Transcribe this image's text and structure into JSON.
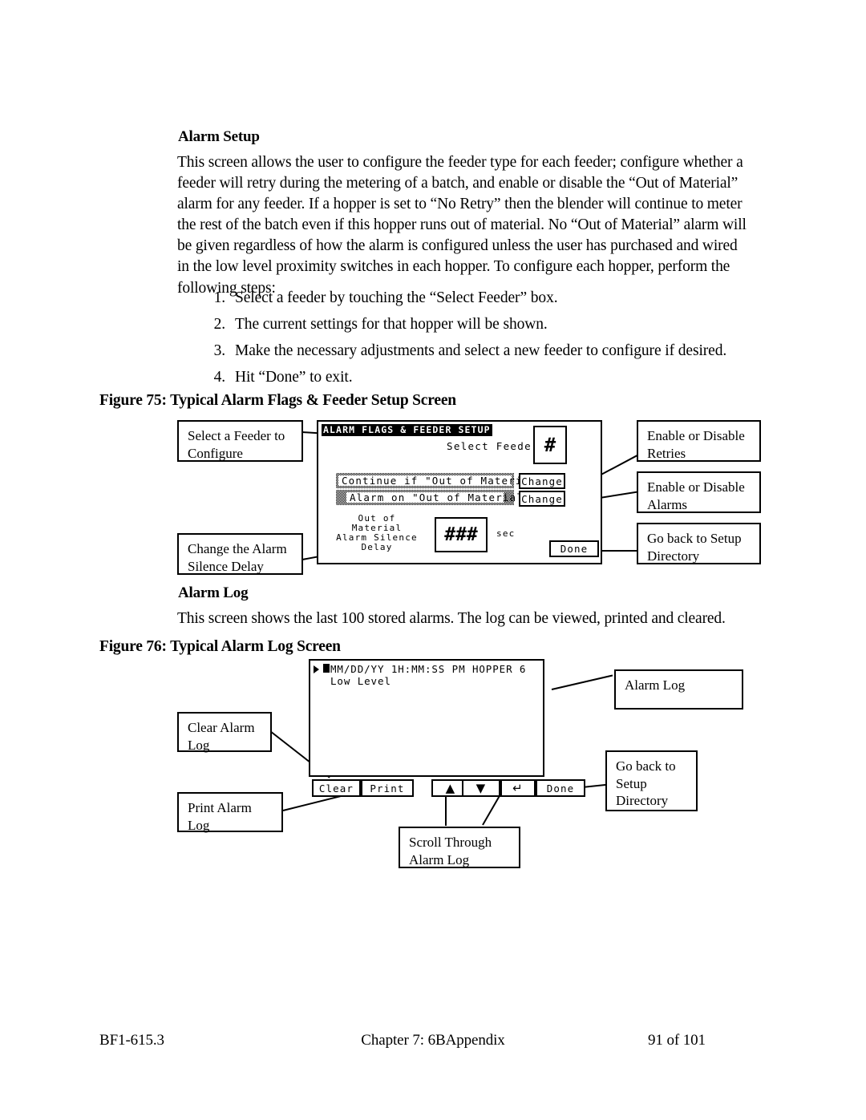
{
  "document": {
    "section_heading": "Alarm Setup",
    "body_paragraph": "This screen allows the user to configure the feeder type for each feeder; configure whether a feeder will retry during the metering of a batch, and enable or disable the “Out of Material” alarm for any feeder.  If a hopper is set to “No Retry” then the blender will continue to meter the rest of the batch even if this hopper runs out of material.  No “Out of Material” alarm will be given regardless of how the alarm is configured unless the user has purchased and wired in the low level proximity switches in each hopper.  To configure each hopper, perform the following steps:",
    "steps": [
      {
        "num": "1.",
        "text": "Select a feeder by touching the “Select Feeder” box."
      },
      {
        "num": "2.",
        "text": "The current settings for that hopper will be shown."
      },
      {
        "num": "3.",
        "text": "Make the necessary adjustments and select a new feeder to configure if desired."
      },
      {
        "num": "4.",
        "text": "Hit “Done” to exit."
      }
    ],
    "alarm_log_heading": "Alarm Log",
    "alarm_log_paragraph": "This screen shows the last 100 stored alarms.  The log can be viewed, printed and cleared."
  },
  "figure75": {
    "caption": "Figure 75: Typical Alarm Flags & Feeder Setup Screen",
    "screen": {
      "title": "ALARM FLAGS & FEEDER SETUP",
      "select_feeder_label": "Select Feeder",
      "select_feeder_value": "#",
      "flag_rows": [
        {
          "label": "Continue if \"Out of Material\"",
          "button": "Change"
        },
        {
          "label": "Alarm on \"Out of Material\"",
          "button": "Change"
        }
      ],
      "delay_label_line1": "Out of",
      "delay_label_line2": "Material",
      "delay_label_line3": "Alarm Silence",
      "delay_label_line4": "Delay",
      "delay_value": "###",
      "delay_units": "sec",
      "done_button": "Done"
    },
    "callouts": {
      "select_feeder": "Select a Feeder to Configure",
      "change_alarm_delay": "Change the Alarm Silence Delay",
      "enable_retries": "Enable or Disable Retries",
      "enable_alarms": "Enable or Disable Alarms",
      "go_back": "Go back to Setup Directory"
    }
  },
  "figure76": {
    "caption": "Figure 76: Typical Alarm Log Screen",
    "screen": {
      "entry_line1": "MM/DD/YY 1H:MM:SS PM HOPPER 6",
      "entry_line2": "Low Level",
      "buttons": {
        "clear": "Clear",
        "print": "Print",
        "scroll_up": "▲",
        "scroll_down": "▼",
        "enter": "↵",
        "done": "Done"
      }
    },
    "callouts": {
      "alarm_log": "Alarm Log",
      "clear_alarm_log": "Clear Alarm Log",
      "print_alarm_log": "Print Alarm Log",
      "scroll_through": "Scroll Through Alarm Log",
      "go_back": "Go back to Setup Directory"
    }
  },
  "footer": {
    "left": "BF1-615.3",
    "center": "Chapter 7: 6BAppendix",
    "right": "91 of 101"
  },
  "colors": {
    "ink": "#000000",
    "paper": "#ffffff"
  }
}
